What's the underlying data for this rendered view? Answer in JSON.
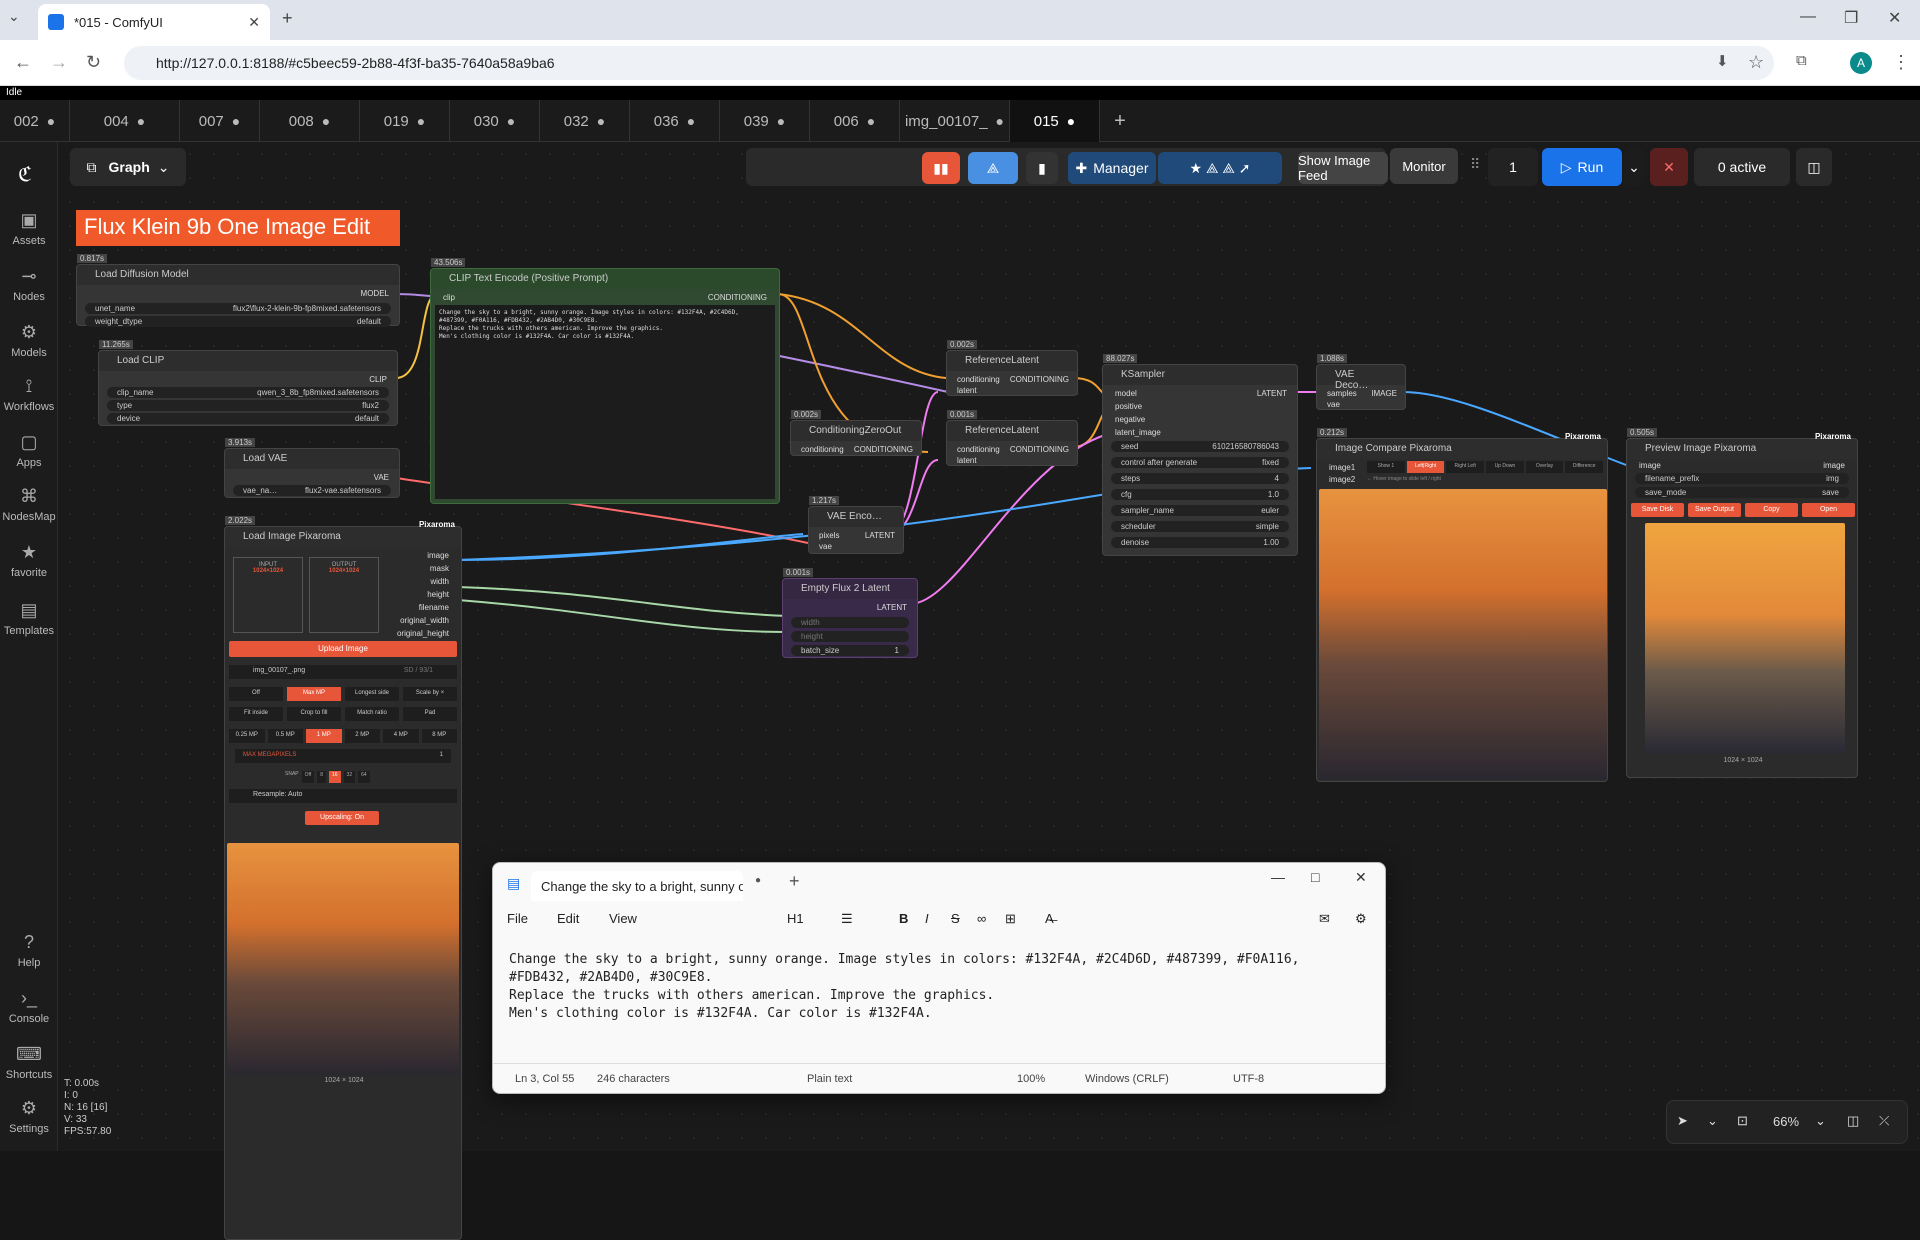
{
  "browser": {
    "tab_title": "*015 - ComfyUI",
    "url": "http://127.0.0.1:8188/#c5beec59-2b88-4f3f-ba35-7640a58a9ba6",
    "avatar": "A"
  },
  "status": {
    "state": "Idle"
  },
  "workflow_tabs": [
    {
      "label": "002"
    },
    {
      "label": "004"
    },
    {
      "label": "007"
    },
    {
      "label": "008"
    },
    {
      "label": "019"
    },
    {
      "label": "030"
    },
    {
      "label": "032"
    },
    {
      "label": "036"
    },
    {
      "label": "039"
    },
    {
      "label": "006"
    },
    {
      "label": "img_00107_"
    },
    {
      "label": "015"
    }
  ],
  "sidebar": {
    "items": [
      {
        "label": "Assets",
        "icon": "image-icon"
      },
      {
        "label": "Nodes",
        "icon": "nodes-icon"
      },
      {
        "label": "Models",
        "icon": "models-icon"
      },
      {
        "label": "Workflows",
        "icon": "workflows-icon"
      },
      {
        "label": "Apps",
        "icon": "apps-icon"
      },
      {
        "label": "NodesMap",
        "icon": "map-icon"
      },
      {
        "label": "favorite",
        "icon": "star-icon"
      },
      {
        "label": "Templates",
        "icon": "templates-icon"
      }
    ],
    "bottom": [
      {
        "label": "Help"
      },
      {
        "label": "Console"
      },
      {
        "label": "Shortcuts"
      },
      {
        "label": "Settings"
      }
    ]
  },
  "toolbar": {
    "graph_label": "Graph",
    "manager_label": "Manager",
    "image_feed_label": "Show Image Feed",
    "monitor_label": "Monitor",
    "queue_count": "1",
    "run_label": "Run",
    "active_label": "0 active"
  },
  "canvas": {
    "title_banner": "Flux Klein 9b One Image Edit",
    "nodes": {
      "diffusion": {
        "time": "0.817s",
        "title": "Load Diffusion Model",
        "out": "MODEL",
        "w1k": "unet_name",
        "w1v": "flux2\\flux-2-klein-9b-fp8mixed.safetensors",
        "w2k": "weight_dtype",
        "w2v": "default"
      },
      "clip": {
        "time": "11.265s",
        "title": "Load CLIP",
        "out": "CLIP",
        "w1k": "clip_name",
        "w1v": "qwen_3_8b_fp8mixed.safetensors",
        "w2k": "type",
        "w2v": "flux2",
        "w3k": "device",
        "w3v": "default"
      },
      "vae": {
        "time": "3.913s",
        "title": "Load VAE",
        "out": "VAE",
        "w1k": "vae_na…",
        "w1v": "flux2-vae.safetensors"
      },
      "textencode": {
        "time": "43.506s",
        "title": "CLIP Text Encode (Positive Prompt)",
        "in": "clip",
        "out": "CONDITIONING",
        "text": "Change the sky to a bright, sunny orange. Image styles in colors: #132F4A, #2C4D6D, #487399, #F0A116, #FDB432, #2AB4D0, #30C9E8.\nReplace the trucks with others american. Improve the graphics.\nMen's clothing color is #132F4A. Car color is #132F4A."
      },
      "ref1": {
        "time": "0.002s",
        "title": "ReferenceLatent",
        "in1": "conditioning",
        "out": "CONDITIONING",
        "in2": "latent"
      },
      "zeroout": {
        "time": "0.002s",
        "title": "ConditioningZeroOut",
        "in": "conditioning",
        "out": "CONDITIONING"
      },
      "ref2": {
        "time": "0.001s",
        "title": "ReferenceLatent",
        "in1": "conditioning",
        "out": "CONDITIONING",
        "in2": "latent"
      },
      "ksampler": {
        "time": "88.027s",
        "title": "KSampler",
        "out": "LATENT",
        "ports": [
          "model",
          "positive",
          "negative",
          "latent_image"
        ],
        "widgets": [
          {
            "k": "seed",
            "v": "610216580786043"
          },
          {
            "k": "control after generate",
            "v": "fixed"
          },
          {
            "k": "steps",
            "v": "4"
          },
          {
            "k": "cfg",
            "v": "1.0"
          },
          {
            "k": "sampler_name",
            "v": "euler"
          },
          {
            "k": "scheduler",
            "v": "simple"
          },
          {
            "k": "denoise",
            "v": "1.00"
          }
        ]
      },
      "vaedecode": {
        "time": "1.088s",
        "title": "VAE Deco…",
        "in1": "samples",
        "in2": "vae",
        "out": "IMAGE"
      },
      "vaeencode": {
        "time": "1.217s",
        "title": "VAE Enco…",
        "in1": "pixels",
        "in2": "vae",
        "out": "LATENT"
      },
      "emptylatent": {
        "time": "0.001s",
        "title": "Empty Flux 2 Latent",
        "out": "LATENT",
        "w1": "width",
        "w2": "height",
        "w3k": "batch_size",
        "w3v": "1"
      },
      "loadimage": {
        "time": "2.022s",
        "title": "Load Image Pixaroma",
        "brand": "Pixaroma",
        "input_label": "INPUT",
        "output_label": "OUTPUT",
        "input_size": "1024×1024",
        "output_size": "1024×1024",
        "outs": [
          "image",
          "mask",
          "width",
          "height",
          "filename",
          "original_width",
          "original_height"
        ],
        "upload": "Upload Image",
        "file": "img_00107_.png",
        "file_meta": "SD / 93/1",
        "modes": [
          "Off",
          "Max MP",
          "Longest side",
          "Scale by ×"
        ],
        "fit": [
          "Fit inside",
          "Crop to fill",
          "Match ratio",
          "Pad"
        ],
        "mp": [
          "0.25 MP",
          "0.5 MP",
          "1 MP",
          "2 MP",
          "4 MP",
          "8 MP"
        ],
        "max_label": "MAX MEGAPIXELS",
        "max_val": "1",
        "snap": "SNAP",
        "snaps": [
          "Off",
          "8",
          "16",
          "32",
          "64"
        ],
        "resample": "Resample: Auto",
        "upscaling": "Upscaling: On",
        "caption": "1024 × 1024"
      },
      "compare": {
        "time": "0.212s",
        "title": "Image Compare Pixaroma",
        "brand": "Pixaroma",
        "in1": "image1",
        "in2": "image2",
        "modes": [
          "Show 1",
          "Left|Right",
          "Right Left",
          "Up Down",
          "Overlay",
          "Difference"
        ],
        "hint": "← Hover image to slide left / right"
      },
      "preview": {
        "time": "0.505s",
        "title": "Preview Image Pixaroma",
        "brand": "Pixaroma",
        "in": "image",
        "out": "image",
        "w1k": "filename_prefix",
        "w1v": "img",
        "w2k": "save_mode",
        "w2v": "save",
        "buttons": [
          "Save Disk",
          "Save Output",
          "Copy",
          "Open"
        ],
        "caption": "1024 × 1024"
      }
    }
  },
  "notepad": {
    "tab_title": "Change the sky to a bright, sunny o",
    "menu": [
      "File",
      "Edit",
      "View"
    ],
    "heading": "H1",
    "text": "Change the sky to a bright, sunny orange. Image styles in colors: #132F4A, #2C4D6D, #487399, #F0A116,\n#FDB432, #2AB4D0, #30C9E8.\nReplace the trucks with others american. Improve the graphics.\nMen's clothing color is #132F4A. Car color is #132F4A.",
    "status": {
      "pos": "Ln 3, Col 55",
      "chars": "246 characters",
      "format": "Plain text",
      "zoom": "100%",
      "eol": "Windows (CRLF)",
      "enc": "UTF-8"
    }
  },
  "stats": {
    "t": "T: 0.00s",
    "i": "I: 0",
    "n": "N: 16 [16]",
    "v": "V: 33",
    "fps": "FPS:57.80"
  },
  "zoom": "66%",
  "colors": {
    "accent": "#e8563a",
    "run": "#1a73e8",
    "banner": "#f05a2a",
    "textencode_bg": "#2f4a30"
  }
}
